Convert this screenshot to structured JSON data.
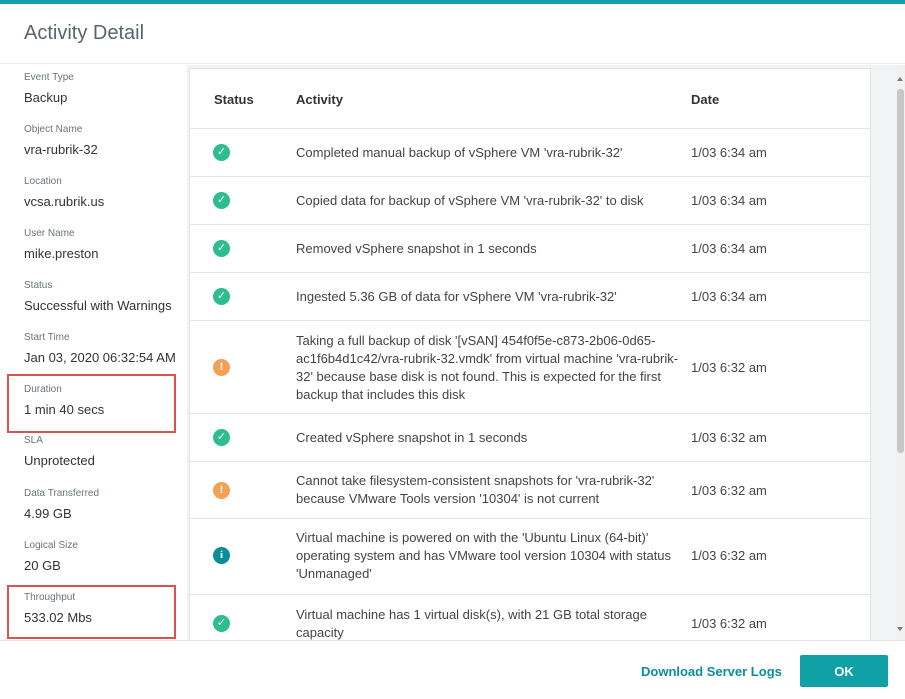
{
  "dialog": {
    "title": "Activity Detail"
  },
  "summary": [
    {
      "label": "Event Type",
      "value": "Backup"
    },
    {
      "label": "Object Name",
      "value": "vra-rubrik-32"
    },
    {
      "label": "Location",
      "value": "vcsa.rubrik.us"
    },
    {
      "label": "User Name",
      "value": "mike.preston"
    },
    {
      "label": "Status",
      "value": "Successful with Warnings"
    },
    {
      "label": "Start Time",
      "value": "Jan 03, 2020 06:32:54 AM"
    },
    {
      "label": "Duration",
      "value": "1 min 40 secs"
    },
    {
      "label": "SLA",
      "value": "Unprotected"
    },
    {
      "label": "Data Transferred",
      "value": "4.99 GB"
    },
    {
      "label": "Logical Size",
      "value": "20 GB"
    },
    {
      "label": "Throughput",
      "value": "533.02 Mbs"
    }
  ],
  "table": {
    "headers": {
      "status": "Status",
      "activity": "Activity",
      "date": "Date"
    },
    "rows": [
      {
        "status": "success",
        "activity": "Completed manual backup of vSphere VM 'vra-rubrik-32'",
        "date": "1/03 6:34 am"
      },
      {
        "status": "success",
        "activity": "Copied data for backup of vSphere VM 'vra-rubrik-32' to disk",
        "date": "1/03 6:34 am"
      },
      {
        "status": "success",
        "activity": "Removed vSphere snapshot in 1 seconds",
        "date": "1/03 6:34 am"
      },
      {
        "status": "success",
        "activity": "Ingested 5.36 GB of data for vSphere VM 'vra-rubrik-32'",
        "date": "1/03 6:34 am"
      },
      {
        "status": "warning",
        "activity": "Taking a full backup of disk '[vSAN] 454f0f5e-c873-2b06-0d65-ac1f6b4d1c42/vra-rubrik-32.vmdk' from virtual machine 'vra-rubrik-32' because base disk is not found. This is expected for the first backup that includes this disk",
        "date": "1/03 6:32 am"
      },
      {
        "status": "success",
        "activity": "Created vSphere snapshot in 1 seconds",
        "date": "1/03 6:32 am"
      },
      {
        "status": "warning",
        "activity": "Cannot take filesystem-consistent snapshots for 'vra-rubrik-32' because VMware Tools version '10304' is not current",
        "date": "1/03 6:32 am"
      },
      {
        "status": "info",
        "activity": "Virtual machine is powered on with the 'Ubuntu Linux (64-bit)' operating system and has VMware tool version 10304 with status 'Unmanaged'",
        "date": "1/03 6:32 am"
      },
      {
        "status": "success",
        "activity": "Virtual machine has 1 virtual disk(s), with 21 GB total storage capacity",
        "date": "1/03 6:32 am"
      }
    ]
  },
  "icons": {
    "success": "check-circle-icon",
    "warning": "exclamation-circle-icon",
    "info": "info-circle-icon"
  },
  "colors": {
    "accent": "#10a1a6",
    "success": "#2ebd8f",
    "warning": "#f2a154",
    "info": "#0b8e99",
    "highlight": "#d9534f"
  },
  "footer": {
    "download_label": "Download Server Logs",
    "ok_label": "OK"
  }
}
